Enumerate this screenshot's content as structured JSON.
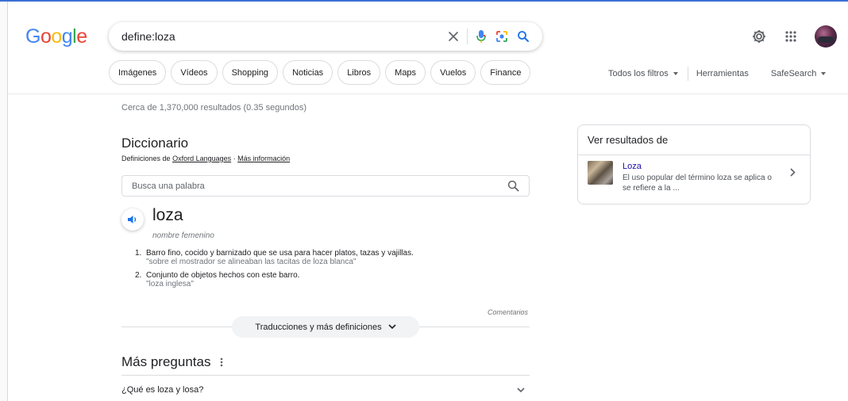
{
  "logo": {
    "letters": [
      "G",
      "o",
      "o",
      "g",
      "l",
      "e"
    ],
    "colors": [
      "#4285f4",
      "#ea4335",
      "#fbbc05",
      "#4285f4",
      "#34a853",
      "#ea4335"
    ]
  },
  "search": {
    "query": "define:loza",
    "icons": [
      "clear-icon",
      "microphone-icon",
      "lens-icon",
      "search-icon"
    ]
  },
  "header_icons": [
    "settings-icon",
    "apps-grid-icon",
    "avatar"
  ],
  "chips": [
    "Imágenes",
    "Vídeos",
    "Shopping",
    "Noticias",
    "Libros",
    "Maps",
    "Vuelos",
    "Finance"
  ],
  "tools": {
    "filters": "Todos los filtros",
    "tools": "Herramientas",
    "safesearch": "SafeSearch"
  },
  "stats": "Cerca de 1,370,000 resultados (0.35 segundos)",
  "dictionary": {
    "title": "Diccionario",
    "source_prefix": "Definiciones de",
    "source": "Oxford Languages",
    "separator": " · ",
    "more_info": "Más información",
    "search_placeholder": "Busca una palabra",
    "word": "loza",
    "part_of_speech": "nombre femenino",
    "definitions": [
      {
        "num": "1.",
        "text": "Barro fino, cocido y barnizado que se usa para hacer platos, tazas y vajillas.",
        "example": "\"sobre el mostrador se alineaban las tacitas de loza blanca\""
      },
      {
        "num": "2.",
        "text": "Conjunto de objetos hechos con este barro.",
        "example": "\"loza inglesa\""
      }
    ],
    "feedback": "Comentarios",
    "more_button": "Traducciones y más definiciones"
  },
  "people_also_ask": {
    "title": "Más preguntas",
    "questions": [
      "¿Qué es loza y losa?"
    ]
  },
  "side_panel": {
    "title": "Ver resultados de",
    "item_title": "Loza",
    "item_desc": "El uso popular del término loza se aplica o se refiere a la ..."
  },
  "colors": {
    "link": "#1a0dab",
    "accent": "#1a73e8",
    "mic_blue": "#4285f4"
  }
}
